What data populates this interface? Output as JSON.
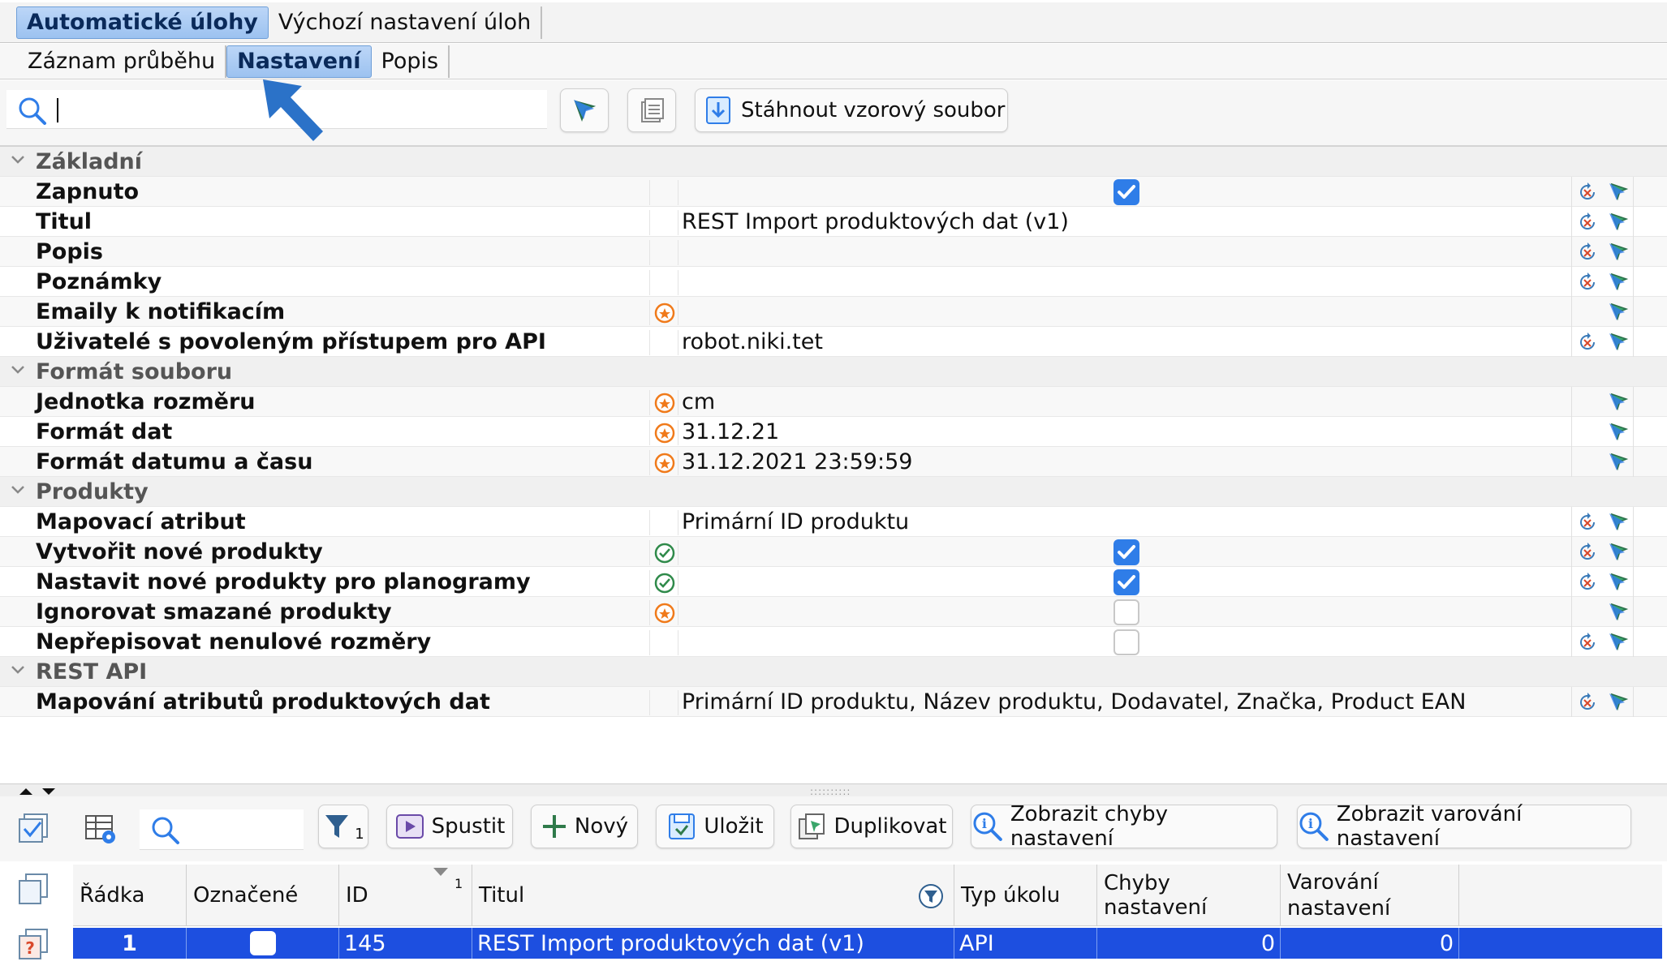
{
  "top_tabs": [
    {
      "label": "Automatické úlohy",
      "active": true
    },
    {
      "label": "Výchozí nastavení úloh",
      "active": false
    }
  ],
  "sub_tabs": [
    {
      "label": "Záznam průběhu",
      "active": false
    },
    {
      "label": "Nastavení",
      "active": true
    },
    {
      "label": "Popis",
      "active": false
    }
  ],
  "toolbar": {
    "search_value": "",
    "download_label": "Stáhnout vzorový soubor"
  },
  "groups": [
    {
      "name": "Základní",
      "rows": [
        {
          "name": "Zapnuto",
          "marker": "none",
          "value": "",
          "checkbox": "checked",
          "reset": true
        },
        {
          "name": "Titul",
          "marker": "none",
          "value": "REST Import produktových dat (v1)",
          "checkbox": "none",
          "reset": true
        },
        {
          "name": "Popis",
          "marker": "none",
          "value": "",
          "checkbox": "none",
          "reset": true
        },
        {
          "name": "Poznámky",
          "marker": "none",
          "value": "",
          "checkbox": "none",
          "reset": true
        },
        {
          "name": "Emaily k notifikacím",
          "marker": "orange",
          "value": "",
          "checkbox": "none",
          "reset": false
        },
        {
          "name": "Uživatelé s povoleným přístupem pro API",
          "marker": "none",
          "value": "robot.niki.tet",
          "checkbox": "none",
          "reset": true
        }
      ]
    },
    {
      "name": "Formát souboru",
      "rows": [
        {
          "name": "Jednotka rozměru",
          "marker": "orange",
          "value": "cm",
          "checkbox": "none",
          "reset": false
        },
        {
          "name": "Formát dat",
          "marker": "orange",
          "value": "31.12.21",
          "checkbox": "none",
          "reset": false
        },
        {
          "name": "Formát datumu a času",
          "marker": "orange",
          "value": "31.12.2021 23:59:59",
          "checkbox": "none",
          "reset": false
        }
      ]
    },
    {
      "name": "Produkty",
      "rows": [
        {
          "name": "Mapovací atribut",
          "marker": "none",
          "value": "Primární ID produktu",
          "checkbox": "none",
          "reset": true
        },
        {
          "name": "Vytvořit nové produkty",
          "marker": "green",
          "value": "",
          "checkbox": "checked",
          "reset": true
        },
        {
          "name": "Nastavit nové produkty pro planogramy",
          "marker": "green",
          "value": "",
          "checkbox": "checked",
          "reset": true
        },
        {
          "name": "Ignorovat smazané produkty",
          "marker": "orange",
          "value": "",
          "checkbox": "unchecked",
          "reset": false
        },
        {
          "name": "Nepřepisovat nenulové rozměry",
          "marker": "none",
          "value": "",
          "checkbox": "unchecked",
          "reset": true
        }
      ]
    },
    {
      "name": "REST API",
      "rows": [
        {
          "name": "Mapování atributů produktových dat",
          "marker": "none",
          "value": "Primární ID produktu, Název produktu, Dodavatel, Značka, Product EAN",
          "checkbox": "none",
          "reset": true
        }
      ]
    }
  ],
  "bottom_toolbar": {
    "search_value": "",
    "filter_count": "1",
    "run_label": "Spustit",
    "new_label": "Nový",
    "save_label": "Uložit",
    "duplicate_label": "Duplikovat",
    "show_errors_label": "Zobrazit chyby nastavení",
    "show_warnings_label": "Zobrazit varování nastavení"
  },
  "table": {
    "columns": [
      "Řádka",
      "Označené",
      "ID",
      "Titul",
      "Typ úkolu",
      "Chyby nastavení",
      "Varování nastavení"
    ],
    "sort_index": "1",
    "rows": [
      {
        "row": "1",
        "id": "145",
        "title": "REST Import produktových dat (v1)",
        "type": "API",
        "errors": "0",
        "warnings": "0"
      }
    ]
  },
  "colors": {
    "selection": "#1d4fe0",
    "checkbox": "#2f7de8",
    "active_tab": "#9cc2f0",
    "arrow": "#2b72c8"
  }
}
